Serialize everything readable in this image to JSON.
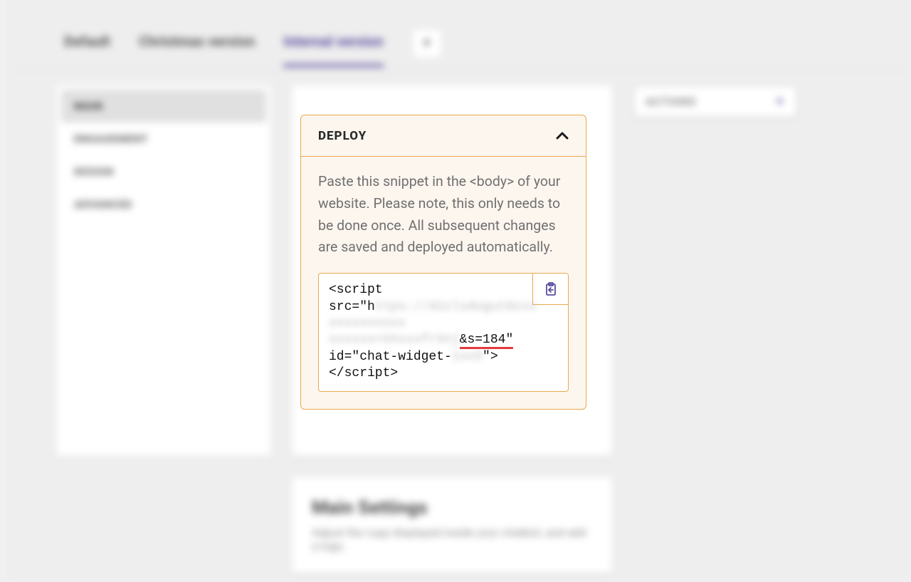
{
  "tabs": {
    "items": [
      "Default",
      "Christmas version",
      "Internal version"
    ],
    "add_label": "+"
  },
  "sidebar": {
    "items": [
      "MAIN",
      "ENGAGEMENT",
      "DESIGN",
      "ADVANCED"
    ]
  },
  "actions": {
    "label": "ACTIONS"
  },
  "deploy": {
    "title": "DEPLOY",
    "description": "Paste this snippet in the <body> of your website. Please note, this only needs to be done once. All subsequent changes are saved and deployed automatically.",
    "snippet": {
      "l1a": "<script",
      "l2a": "src=\"h",
      "l2b": "ttps://d2zlsdogut0zxx",
      "l3a": "xxxxxxxxxx",
      "l4a": "xxxxxx=#XxxxfrXnj",
      "l4b": "&s=184\"",
      "l5a": "id=\"chat-widget-",
      "l5b": "1xx5",
      "l5c": "\">",
      "l6a": "</script>"
    }
  },
  "lower": {
    "title": "Main Settings",
    "desc": "Adjust the copy displayed inside your chatbot, and add a logo."
  }
}
